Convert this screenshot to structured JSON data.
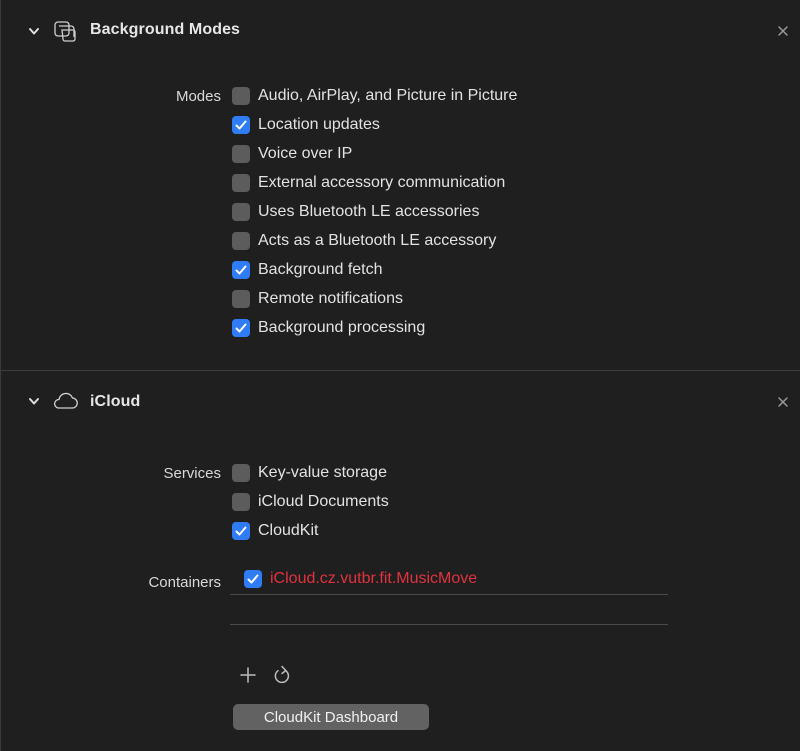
{
  "background_modes": {
    "title": "Background Modes",
    "modes_label": "Modes",
    "modes": [
      {
        "label": "Audio, AirPlay, and Picture in Picture",
        "checked": false
      },
      {
        "label": "Location updates",
        "checked": true
      },
      {
        "label": "Voice over IP",
        "checked": false
      },
      {
        "label": "External accessory communication",
        "checked": false
      },
      {
        "label": "Uses Bluetooth LE accessories",
        "checked": false
      },
      {
        "label": "Acts as a Bluetooth LE accessory",
        "checked": false
      },
      {
        "label": "Background fetch",
        "checked": true
      },
      {
        "label": "Remote notifications",
        "checked": false
      },
      {
        "label": "Background processing",
        "checked": true
      }
    ]
  },
  "icloud": {
    "title": "iCloud",
    "services_label": "Services",
    "services": [
      {
        "label": "Key-value storage",
        "checked": false
      },
      {
        "label": "iCloud Documents",
        "checked": false
      },
      {
        "label": "CloudKit",
        "checked": true
      }
    ],
    "containers_label": "Containers",
    "containers": [
      {
        "label": "iCloud.cz.vutbr.fit.MusicMove",
        "checked": true
      }
    ],
    "dashboard_button": "CloudKit Dashboard"
  },
  "icons": {
    "collapse": "chevron-down-icon",
    "background_modes": "stacked-windows-icon",
    "icloud": "cloud-icon",
    "close": "close-icon",
    "add": "plus-icon",
    "refresh": "refresh-icon"
  },
  "colors": {
    "background": "#1f1f1f",
    "checkbox_checked": "#2f7cf6",
    "checkbox_unchecked": "#5c5c5c",
    "container_error_text": "#e0323f",
    "button_background": "#626262"
  }
}
